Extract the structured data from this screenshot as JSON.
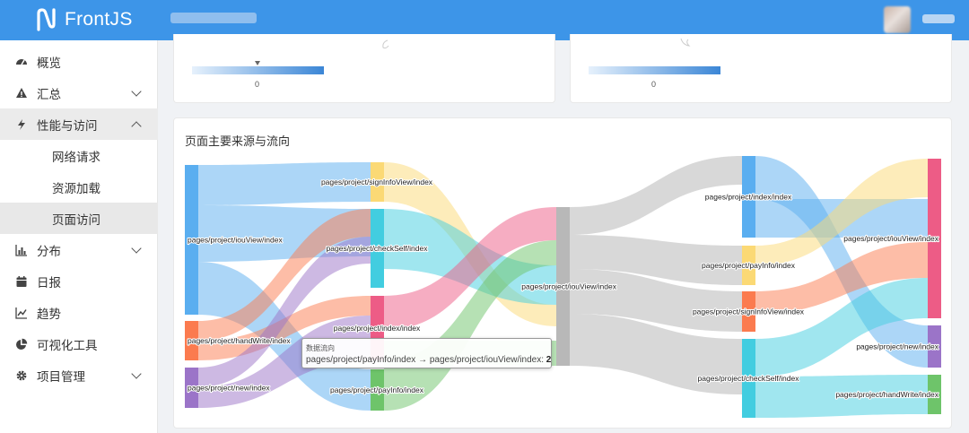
{
  "app": {
    "name": "FrontJS",
    "title_blurred": "",
    "user_blurred": ""
  },
  "sidebar": {
    "items": [
      {
        "label": "概览",
        "icon": "dashboard-icon"
      },
      {
        "label": "汇总",
        "icon": "warning-icon",
        "expandable": true
      },
      {
        "label": "性能与访问",
        "icon": "bolt-icon",
        "expandable": true,
        "expanded": true,
        "children": [
          {
            "label": "网络请求"
          },
          {
            "label": "资源加载"
          },
          {
            "label": "页面访问",
            "active": true
          }
        ]
      },
      {
        "label": "分布",
        "icon": "bar-chart-icon",
        "expandable": true
      },
      {
        "label": "日报",
        "icon": "calendar-icon"
      },
      {
        "label": "趋势",
        "icon": "line-chart-icon"
      },
      {
        "label": "可视化工具",
        "icon": "pie-chart-icon"
      },
      {
        "label": "项目管理",
        "icon": "gear-icon",
        "expandable": true
      }
    ]
  },
  "map_cards": [
    {
      "legend_value": "0"
    },
    {
      "legend_value": "0"
    }
  ],
  "sankey_card": {
    "title": "页面主要来源与流向"
  },
  "chart_data": {
    "type": "sankey",
    "colors": {
      "iouView": "#5aaef0",
      "signInfoView": "#fbd975",
      "checkSelf": "#42cde0",
      "index": "#ed5c86",
      "handWrite": "#fb7b4f",
      "payInfo": "#6ec46a",
      "new": "#9b74c8",
      "center": "#b8b8b8"
    },
    "nodes_col1": [
      {
        "name": "pages/project/iouView/index",
        "color": "#5aaef0"
      },
      {
        "name": "pages/project/handWrite/index",
        "color": "#fb7b4f"
      },
      {
        "name": "pages/project/new/index",
        "color": "#9b74c8"
      }
    ],
    "nodes_col2": [
      {
        "name": "pages/project/signInfoView/index",
        "color": "#fbd975"
      },
      {
        "name": "pages/project/checkSelf/index",
        "color": "#42cde0"
      },
      {
        "name": "pages/project/index/index",
        "color": "#ed5c86"
      },
      {
        "name": "pages/project/payInfo/index",
        "color": "#6ec46a"
      }
    ],
    "nodes_col3": [
      {
        "name": "pages/project/iouView/index",
        "color": "#b8b8b8"
      }
    ],
    "nodes_col4": [
      {
        "name": "pages/project/index/index",
        "color": "#5aaef0"
      },
      {
        "name": "pages/project/payInfo/index",
        "color": "#fbd975"
      },
      {
        "name": "pages/project/signInfoView/index",
        "color": "#fb7b4f"
      },
      {
        "name": "pages/project/checkSelf/index",
        "color": "#42cde0"
      }
    ],
    "nodes_col5": [
      {
        "name": "pages/project/iouView/index",
        "color": "#ed5c86"
      },
      {
        "name": "pages/project/new/index",
        "color": "#9b74c8"
      },
      {
        "name": "pages/project/handWrite/index",
        "color": "#6ec46a"
      }
    ]
  },
  "tooltip": {
    "title": "数据流向",
    "source": "pages/project/payInfo/index",
    "arrow": "→",
    "target": "pages/project/iouView/index",
    "value": "2"
  }
}
